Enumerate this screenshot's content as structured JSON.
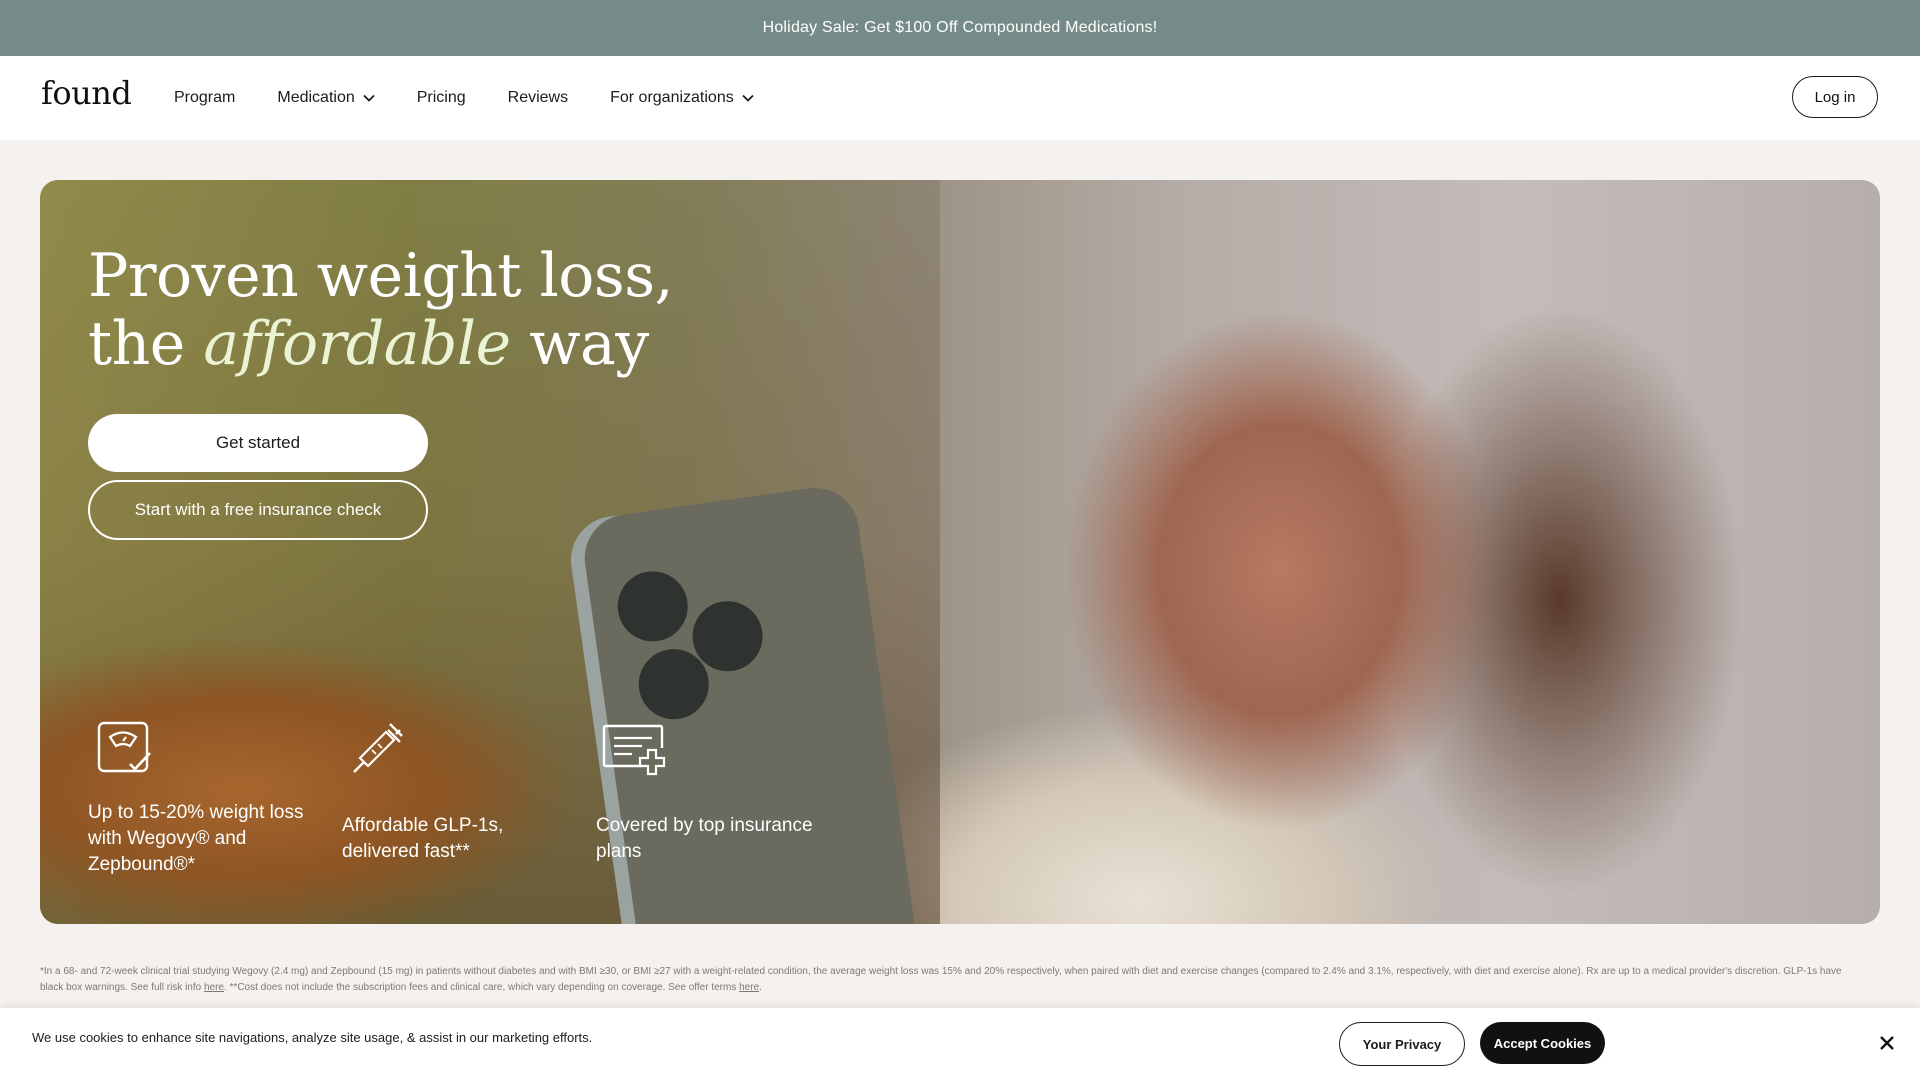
{
  "promo": {
    "text": "Holiday Sale: Get $100 Off Compounded Medications!"
  },
  "nav": {
    "logo": "found",
    "items": [
      {
        "label": "Program",
        "has_dropdown": false
      },
      {
        "label": "Medication",
        "has_dropdown": true
      },
      {
        "label": "Pricing",
        "has_dropdown": false
      },
      {
        "label": "Reviews",
        "has_dropdown": false
      },
      {
        "label": "For organizations",
        "has_dropdown": true
      }
    ],
    "login": "Log in"
  },
  "hero": {
    "title_line1": "Proven weight loss,",
    "title_line2_pre": "the ",
    "title_line2_em": "affordable",
    "title_line2_post": " way",
    "primary_cta": "Get started",
    "secondary_cta": "Start with a free insurance check",
    "features": [
      {
        "icon": "scale-check-icon",
        "text": "Up to 15-20% weight loss with Wegovy® and Zepbound®*"
      },
      {
        "icon": "syringe-icon",
        "text": "Affordable GLP-1s, delivered fast**"
      },
      {
        "icon": "insurance-card-icon",
        "text": "Covered by top insurance plans"
      }
    ]
  },
  "disclaimer": {
    "part1": "*In a 68- and 72-week clinical trial studying Wegovy (2.4 mg) and Zepbound (15 mg) in patients without diabetes and with BMI ≥30, or BMI ≥27 with a weight-related condition, the average weight loss was 15% and 20% respectively, when paired with diet and exercise changes (compared to 2.4% and 3.1%, respectively, with diet and exercise alone). Rx are up to a medical provider's discretion. GLP-1s have black box warnings. See full risk info ",
    "link1": "here",
    "part2": ". **Cost does not include the subscription fees and clinical care, which vary depending on coverage. See offer terms ",
    "link2": "here",
    "part3": "."
  },
  "cookie": {
    "text": "We use cookies to enhance site navigations, analyze site usage, & assist in our marketing efforts.",
    "privacy": "Your Privacy",
    "accept": "Accept Cookies"
  },
  "colors": {
    "promo_bg": "#748b88",
    "page_bg": "#f5f1ee",
    "accent_em": "#eaf3d4",
    "accept_bg": "#111111"
  }
}
